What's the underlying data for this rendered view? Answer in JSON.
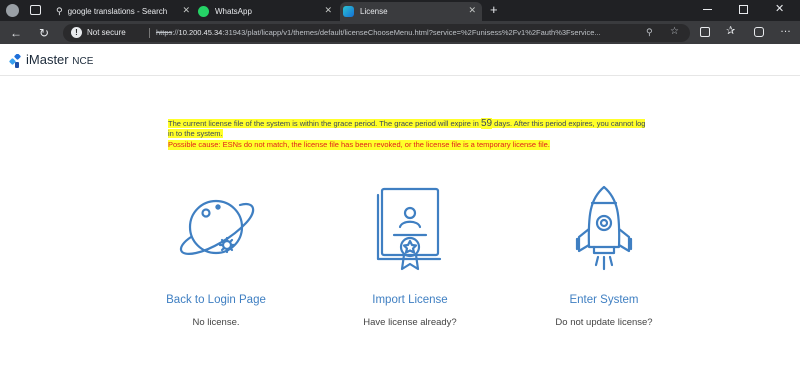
{
  "browser": {
    "tabs": [
      {
        "label": "google translations - Search",
        "icon": "search-icon"
      },
      {
        "label": "WhatsApp",
        "icon": "whatsapp-icon"
      },
      {
        "label": "License",
        "icon": "edge-icon",
        "active": true
      }
    ],
    "security_label": "Not secure",
    "url": {
      "scheme": "https",
      "sep": "://",
      "host": "10.200.45.34",
      "rest": ":31943/plat/licapp/v1/themes/default/licenseChooseMenu.html?service=%2Funisess%2Fv1%2Fauth%3Fservice..."
    },
    "colors": {
      "chrome": "#202124",
      "toolbar": "#3a3b3e",
      "whatsapp": "#25d366"
    }
  },
  "app": {
    "brand": "iMaster",
    "brand_suffix": "NCE"
  },
  "notice": {
    "line1_a": "The current license file of the system is within the grace period. The grace period will expire in ",
    "days": "59",
    "line1_b": " days. After this period expires, you cannot log in to the system.",
    "line2": "Possible cause: ESNs do not match, the license file has been revoked, or the license file is a temporary license file.",
    "highlight_color": "#ffff2a",
    "warning_color": "#e0201d"
  },
  "options": [
    {
      "title": "Back to Login Page",
      "subtitle": "No license.",
      "icon": "planet-gear-icon"
    },
    {
      "title": "Import License",
      "subtitle": "Have license already?",
      "icon": "certificate-icon"
    },
    {
      "title": "Enter System",
      "subtitle": "Do not update license?",
      "icon": "rocket-icon"
    }
  ],
  "accent_color": "#3f7fc2"
}
